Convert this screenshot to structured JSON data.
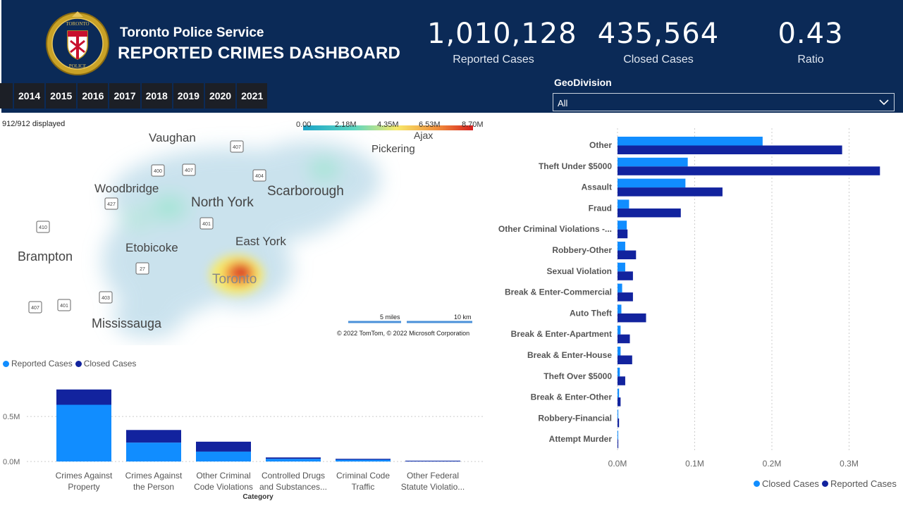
{
  "header": {
    "org": "Toronto Police Service",
    "title": "REPORTED CRIMES DASHBOARD",
    "logo_text_top": "TORONTO",
    "logo_text_bottom": "POLICE",
    "kpis": [
      {
        "value": "1,010,128",
        "label": "Reported Cases"
      },
      {
        "value": "435,564",
        "label": "Closed Cases"
      },
      {
        "value": "0.43",
        "label": "Ratio"
      }
    ],
    "years": [
      "2014",
      "2015",
      "2016",
      "2017",
      "2018",
      "2019",
      "2020",
      "2021"
    ],
    "geo_label": "GeoDivision",
    "geo_value": "All"
  },
  "map": {
    "displayed": "912/912 displayed",
    "color_scale": [
      "0.00",
      "2.18M",
      "4.35M",
      "6.53M",
      "8.70M"
    ],
    "cities": [
      "Vaughan",
      "Ajax",
      "Pickering",
      "Woodbridge",
      "North York",
      "Scarborough",
      "Etobicoke",
      "East York",
      "Brampton",
      "Toronto",
      "Mississauga"
    ],
    "highways": [
      "407",
      "400",
      "407",
      "404",
      "427",
      "401",
      "410",
      "27",
      "403",
      "407",
      "401"
    ],
    "scale_miles": "5 miles",
    "scale_km": "10 km",
    "copyright": "© 2022 TomTom, © 2022 Microsoft Corporation"
  },
  "colors": {
    "header_bg": "#0b2a57",
    "reported": "#118dff",
    "closed": "#12239e",
    "year_btn": "#1c1f26"
  },
  "chart_data": [
    {
      "type": "bar",
      "orientation": "vertical-stacked",
      "legend": [
        "Reported Cases",
        "Closed Cases"
      ],
      "xlabel": "Category",
      "categories": [
        "Crimes Against Property",
        "Crimes Against the Person",
        "Other Criminal Code Violations",
        "Controlled Drugs and Substances...",
        "Criminal Code Traffic",
        "Other Federal Statute Violatio..."
      ],
      "category_lines": [
        [
          "Crimes Against",
          "Property"
        ],
        [
          "Crimes Against",
          "the Person"
        ],
        [
          "Other Criminal",
          "Code Violations"
        ],
        [
          "Controlled Drugs",
          "and Substances..."
        ],
        [
          "Criminal Code",
          "Traffic"
        ],
        [
          "Other Federal",
          "Statute Violatio..."
        ]
      ],
      "series": [
        {
          "name": "Reported Cases",
          "values": [
            0.63,
            0.21,
            0.11,
            0.03,
            0.02,
            0.005
          ]
        },
        {
          "name": "Closed Cases",
          "values": [
            0.17,
            0.14,
            0.11,
            0.015,
            0.01,
            0.004
          ]
        }
      ],
      "yticks": [
        "0.0M",
        "0.5M"
      ],
      "ylim": [
        0,
        0.9
      ]
    },
    {
      "type": "bar",
      "orientation": "horizontal",
      "legend": [
        "Closed Cases",
        "Reported Cases"
      ],
      "categories": [
        "Other",
        "Theft Under $5000",
        "Assault",
        "Fraud",
        "Other Criminal Violations -...",
        "Robbery-Other",
        "Sexual Violation",
        "Break & Enter-Commercial",
        "Auto Theft",
        "Break & Enter-Apartment",
        "Break & Enter-House",
        "Theft Over $5000",
        "Break & Enter-Other",
        "Robbery-Financial",
        "Attempt Murder"
      ],
      "series": [
        {
          "name": "Closed Cases",
          "values": [
            0.188,
            0.091,
            0.088,
            0.015,
            0.012,
            0.01,
            0.01,
            0.006,
            0.005,
            0.004,
            0.004,
            0.003,
            0.002,
            0.001,
            0.0005
          ]
        },
        {
          "name": "Reported Cases",
          "values": [
            0.291,
            0.34,
            0.136,
            0.082,
            0.013,
            0.024,
            0.02,
            0.02,
            0.037,
            0.016,
            0.019,
            0.01,
            0.004,
            0.002,
            0.001
          ]
        }
      ],
      "xticks": [
        "0.0M",
        "0.1M",
        "0.2M",
        "0.3M"
      ],
      "xlim": [
        0,
        0.36
      ]
    }
  ]
}
